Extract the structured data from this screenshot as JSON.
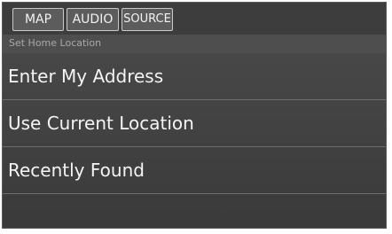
{
  "tabs": [
    {
      "label": "MAP"
    },
    {
      "label": "AUDIO"
    },
    {
      "label": "SOURCE"
    }
  ],
  "screen_title": "Set Home Location",
  "menu_items": [
    {
      "label": "Enter My Address"
    },
    {
      "label": "Use Current Location"
    },
    {
      "label": "Recently Found"
    }
  ],
  "colors": {
    "background": "#444444",
    "text": "#f4f4f4",
    "subtitle_text": "#a9a9a9",
    "tab_border": "#c9c9c9"
  }
}
